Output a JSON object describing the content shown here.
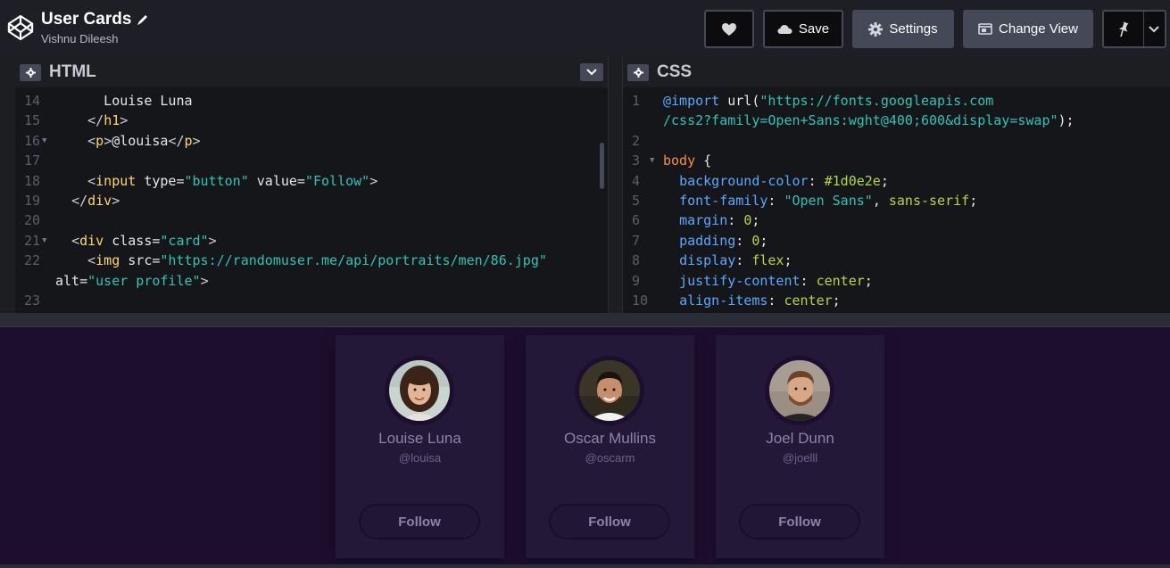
{
  "header": {
    "title": "User Cards",
    "author": "Vishnu Dileesh",
    "buttons": {
      "save": "Save",
      "settings": "Settings",
      "change_view": "Change View"
    },
    "icons": [
      "codepen-logo-icon",
      "pencil-icon",
      "heart-icon",
      "cloud-icon",
      "gear-icon",
      "layout-icon",
      "pin-icon",
      "chevron-down-icon"
    ]
  },
  "html_editor": {
    "title": "HTML",
    "lines": [
      {
        "n": "14",
        "fold": false,
        "html": "      Louise Luna"
      },
      {
        "n": "15",
        "fold": false,
        "html": "    <span class=\"p\">&lt;/</span><span class=\"t\">h1</span><span class=\"p\">&gt;</span>"
      },
      {
        "n": "16",
        "fold": true,
        "html": "    <span class=\"p\">&lt;</span><span class=\"t\">p</span><span class=\"p\">&gt;</span>@louisa<span class=\"p\">&lt;/</span><span class=\"t\">p</span><span class=\"p\">&gt;</span>"
      },
      {
        "n": "17",
        "fold": false,
        "html": ""
      },
      {
        "n": "18",
        "fold": false,
        "html": "    <span class=\"p\">&lt;</span><span class=\"t\">input</span> type=<span class=\"s\">\"button\"</span> value=<span class=\"s\">\"Follow\"</span><span class=\"p\">&gt;</span>"
      },
      {
        "n": "19",
        "fold": false,
        "html": "  <span class=\"p\">&lt;/</span><span class=\"t\">div</span><span class=\"p\">&gt;</span>"
      },
      {
        "n": "20",
        "fold": false,
        "html": ""
      },
      {
        "n": "21",
        "fold": true,
        "html": "  <span class=\"p\">&lt;</span><span class=\"t\">div</span> class=<span class=\"s\">\"card\"</span><span class=\"p\">&gt;</span>"
      },
      {
        "n": "22",
        "fold": false,
        "html": "    <span class=\"p\">&lt;</span><span class=\"t\">img</span> src=<span class=\"s\">\"https://randomuser.me/api/portraits/men/86.jpg\"</span>"
      },
      {
        "n": "",
        "fold": false,
        "html": "alt=<span class=\"s\">\"user profile\"</span><span class=\"p\">&gt;</span>"
      },
      {
        "n": "23",
        "fold": false,
        "html": ""
      }
    ]
  },
  "css_editor": {
    "title": "CSS",
    "lines": [
      {
        "n": "1",
        "fold": false,
        "html": "<span class=\"prop\">@import</span> url(<span class=\"str\">\"https://fonts.googleapis.com</span>"
      },
      {
        "n": "",
        "fold": false,
        "html": "<span class=\"str\">/css2?family=Open+Sans:wght@400;600&amp;display=swap\"</span>);"
      },
      {
        "n": "2",
        "fold": false,
        "html": ""
      },
      {
        "n": "3",
        "fold": true,
        "html": "<span class=\"kw\">body</span> {"
      },
      {
        "n": "4",
        "fold": false,
        "html": "  <span class=\"prop\">background-color</span>: <span class=\"val\">#1d0e2e</span>;"
      },
      {
        "n": "5",
        "fold": false,
        "html": "  <span class=\"prop\">font-family</span>: <span class=\"str\">\"Open Sans\"</span>, <span class=\"val\">sans-serif</span>;"
      },
      {
        "n": "6",
        "fold": false,
        "html": "  <span class=\"prop\">margin</span>: <span class=\"val\">0</span>;"
      },
      {
        "n": "7",
        "fold": false,
        "html": "  <span class=\"prop\">padding</span>: <span class=\"val\">0</span>;"
      },
      {
        "n": "8",
        "fold": false,
        "html": "  <span class=\"prop\">display</span>: <span class=\"val\">flex</span>;"
      },
      {
        "n": "9",
        "fold": false,
        "html": "  <span class=\"prop\">justify-content</span>: <span class=\"val\">center</span>;"
      },
      {
        "n": "10",
        "fold": false,
        "html": "  <span class=\"prop\">align-items</span>: <span class=\"val\">center</span>;"
      }
    ]
  },
  "preview": {
    "cards": [
      {
        "name": "Louise Luna",
        "handle": "@louisa",
        "button": "Follow"
      },
      {
        "name": "Oscar Mullins",
        "handle": "@oscarm",
        "button": "Follow"
      },
      {
        "name": "Joel Dunn",
        "handle": "@joelll",
        "button": "Follow"
      }
    ]
  },
  "colors": {
    "topbar": "#1e1f26",
    "button": "#444857",
    "editor_bg": "#151619",
    "preview_bg": "#1d0e2e",
    "card_bg": "#241838",
    "card_text": "#8f82a8"
  }
}
